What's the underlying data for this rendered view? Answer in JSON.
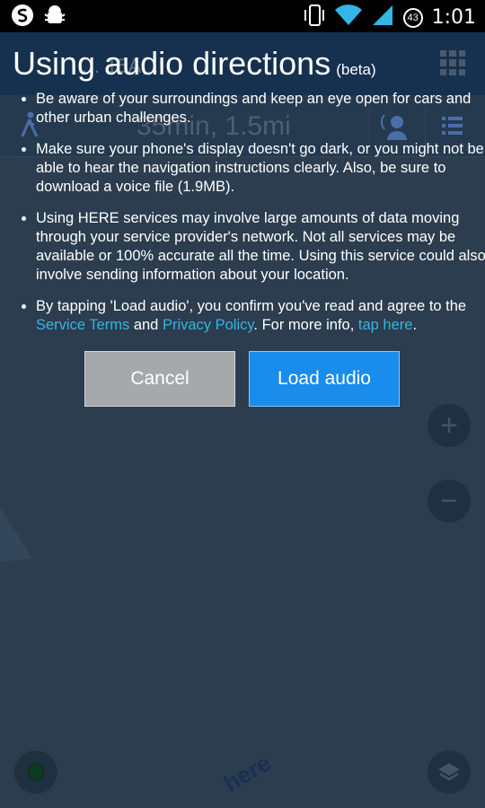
{
  "status_bar": {
    "time": "1:01",
    "battery_level": "43",
    "icons": [
      "swiftkey-icon",
      "android-debug-icon",
      "vibrate-icon",
      "wifi-icon",
      "signal-icon",
      "battery-icon"
    ]
  },
  "dialog": {
    "title": "Using audio directions",
    "title_suffix": "(beta)",
    "bullet1": "Be aware of your surroundings and keep an eye open for cars and other urban challenges.",
    "bullet2": "Make sure your phone's display doesn't go dark, or you might not be able to hear the navigation instructions clearly. Also, be sure to download a voice file (1.9MB).",
    "bullet3": "Using HERE services may involve large amounts of data moving through your service provider's network. Not all services may be available or 100% accurate all the time. Using this service could also involve sending information about your location.",
    "bullet4": {
      "prefix": "By tapping 'Load audio', you confirm you've read and agree to the",
      "link_terms": "Service Terms",
      "and": "and",
      "link_privacy": "Privacy Policy",
      "suffix": ". For more info,",
      "link_more": "tap here",
      "end": "."
    },
    "cancel_label": "Cancel",
    "load_label": "Load audio"
  },
  "background": {
    "route_title": "… 15A, …",
    "eta": "35min, 1.5mi",
    "zoom_in": "+",
    "zoom_out": "−",
    "logo": "here"
  },
  "colors": {
    "link": "#33b5e5",
    "load_button": "#1a8ceb",
    "cancel_button": "#a6a8ab",
    "overlay_bg": "#2b3d4f"
  }
}
